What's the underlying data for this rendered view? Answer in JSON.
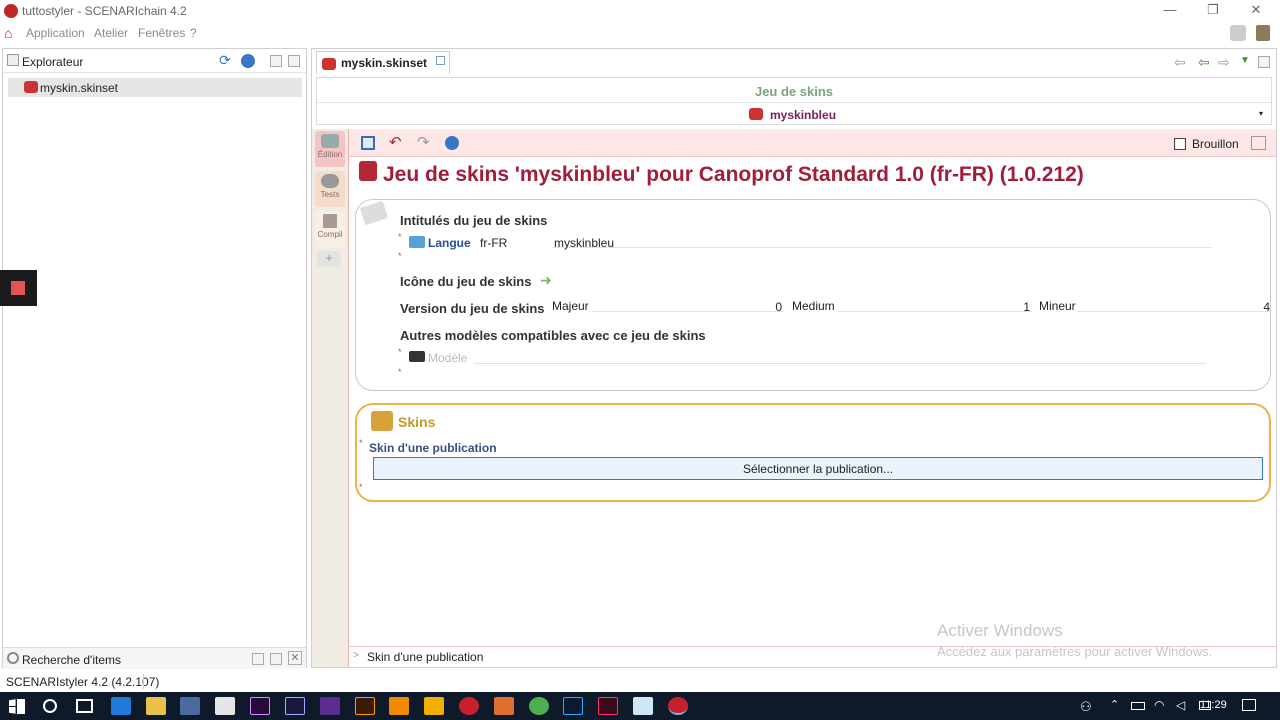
{
  "window": {
    "title": "tuttostyler - SCENARIchain 4.2",
    "minimize": "—",
    "restore": "❐",
    "close": "✕"
  },
  "menu": {
    "items": [
      "Application",
      "Atelier",
      "Fenêtres",
      "?"
    ]
  },
  "explorer": {
    "title": "Explorateur",
    "item": "myskin.skinset",
    "search_title": "Recherche d'items"
  },
  "editor": {
    "tab": "myskin.skinset",
    "header_type": "Jeu de skins",
    "header_value": "myskinbleu",
    "brouillon": "Brouillon",
    "side": {
      "edition": "Édition",
      "tests": "Tests",
      "compil": "Compil"
    },
    "main_title": "Jeu de skins 'myskinbleu' pour Canoprof Standard 1.0 (fr-FR) (1.0.212)",
    "intitules": {
      "label": "Intitulés du jeu de skins",
      "langue_label": "Langue",
      "langue_value": "fr-FR",
      "name_value": "myskinbleu"
    },
    "icone_label": "Icône du jeu de skins",
    "version": {
      "label": "Version du jeu de skins",
      "majeur_label": "Majeur",
      "majeur_value": "0",
      "medium_label": "Medium",
      "medium_value": "1",
      "mineur_label": "Mineur",
      "mineur_value": "4"
    },
    "autres": {
      "label": "Autres modèles compatibles avec ce jeu de skins",
      "modele_placeholder": "Modèle"
    },
    "skins": {
      "title": "Skins",
      "sub": "Skin d'une publication",
      "button": "Sélectionner la publication..."
    },
    "bottom_path": "Skin d'une publication"
  },
  "watermark": {
    "line1": "Activer Windows",
    "line2": "Accédez aux paramètres pour activer Windows."
  },
  "statusbar": {
    "text": "SCENARIstyler 4.2 (4.2.107)"
  },
  "taskbar": {
    "time": "11:29"
  }
}
